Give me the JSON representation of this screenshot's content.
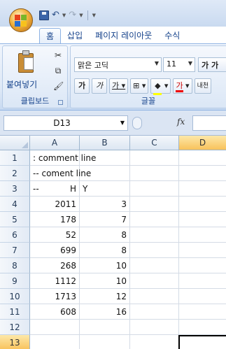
{
  "quick_access": {
    "undo": "↶",
    "redo": "↷"
  },
  "tabs": [
    {
      "label": "홈",
      "active": true
    },
    {
      "label": "삽입",
      "active": false
    },
    {
      "label": "페이지 레이아웃",
      "active": false
    },
    {
      "label": "수식",
      "active": false
    }
  ],
  "ribbon": {
    "clipboard": {
      "paste_label": "붙여넣기",
      "group_label": "클립보드"
    },
    "font": {
      "font_name": "맑은 고딕",
      "font_size": "11",
      "grow_label": "가 가",
      "bold": "가",
      "italic": "가",
      "underline": "가",
      "font_color": "가",
      "phonetic": "내천",
      "group_label": "글꼴"
    }
  },
  "formula_bar": {
    "name_box": "D13",
    "fx": "fx",
    "formula": ""
  },
  "columns": [
    "A",
    "B",
    "C",
    "D"
  ],
  "selected_column": "D",
  "selected_row": "13",
  "rows": [
    {
      "num": "1",
      "a": ": comment line",
      "b": ""
    },
    {
      "num": "2",
      "a": "-- coment line",
      "b": ""
    },
    {
      "num": "3",
      "a": "--",
      "a2": "H",
      "b": "Y"
    },
    {
      "num": "4",
      "a": "2011",
      "b": "3"
    },
    {
      "num": "5",
      "a": "178",
      "b": "7"
    },
    {
      "num": "6",
      "a": "52",
      "b": "8"
    },
    {
      "num": "7",
      "a": "699",
      "b": "8"
    },
    {
      "num": "8",
      "a": "268",
      "b": "10"
    },
    {
      "num": "9",
      "a": "1112",
      "b": "10"
    },
    {
      "num": "10",
      "a": "1713",
      "b": "12"
    },
    {
      "num": "11",
      "a": "608",
      "b": "16"
    },
    {
      "num": "12",
      "a": "",
      "b": ""
    },
    {
      "num": "13",
      "a": "",
      "b": ""
    }
  ]
}
